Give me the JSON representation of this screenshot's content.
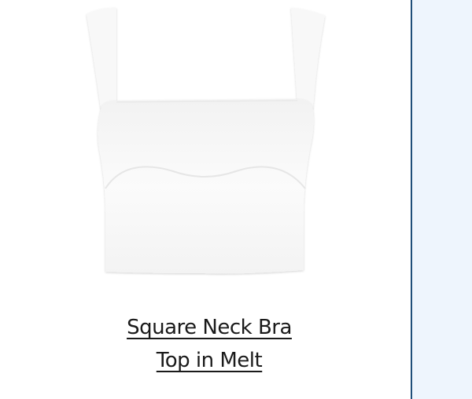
{
  "product": {
    "title_line1": "Square Neck Bra",
    "title_line2": "Top in Melt",
    "image_icon": "square-neck-bra-top-image",
    "garment_color": "#fbfbfb"
  },
  "side_panel": {
    "background": "#eef5fd",
    "border_color": "#1f4f7a"
  }
}
